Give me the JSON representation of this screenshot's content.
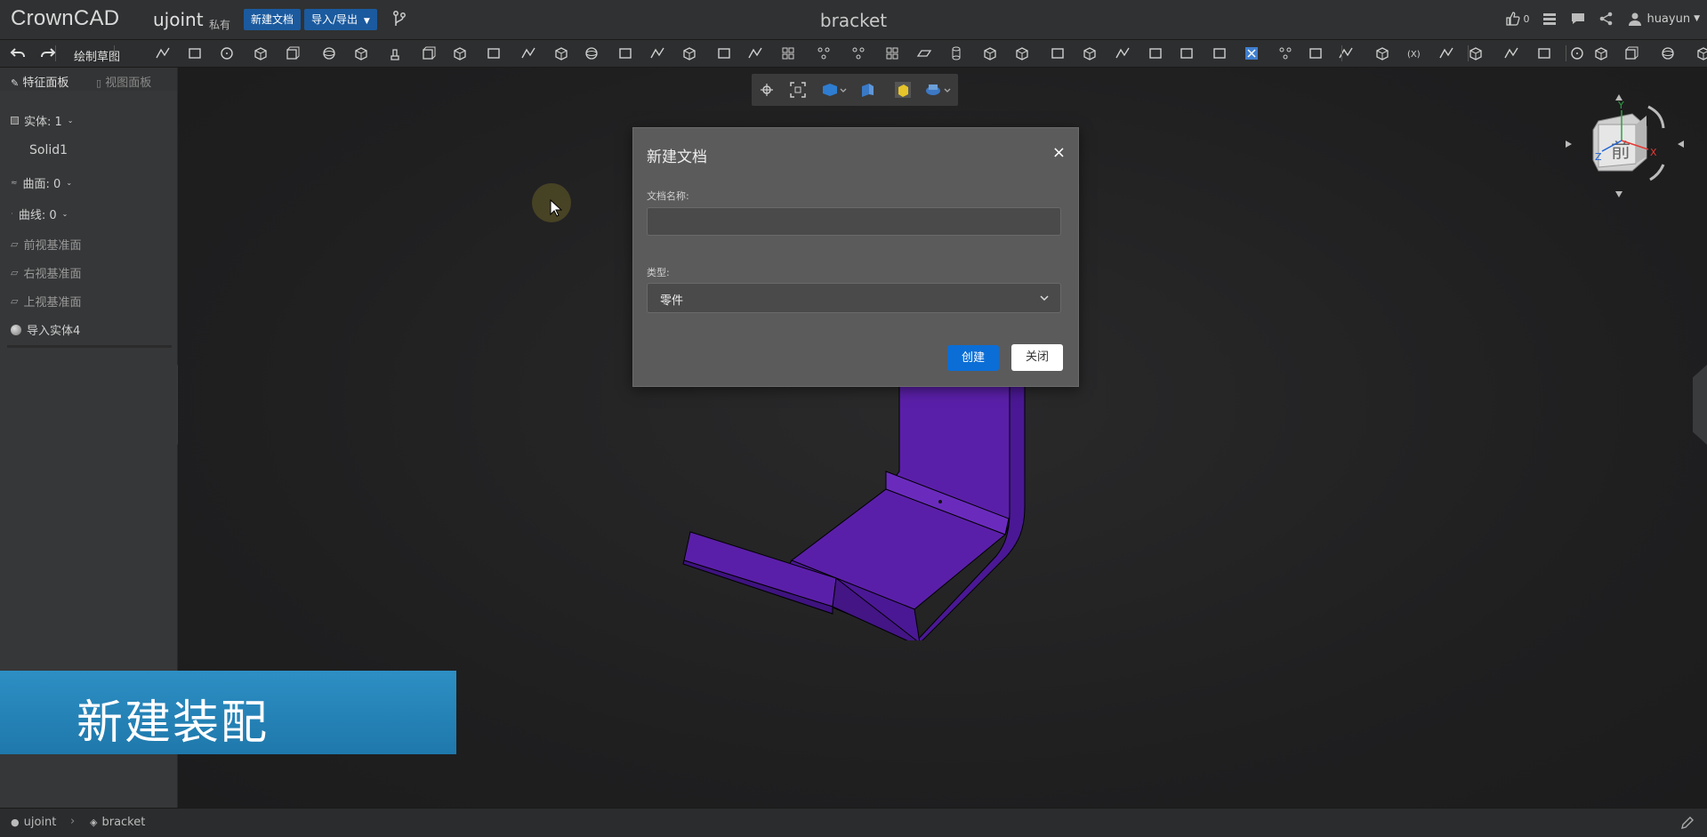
{
  "app": {
    "logo": "CrownCAD",
    "project": "ujoint",
    "privacy": "私有",
    "new_doc_label": "新建文档",
    "import_export_label": "导入/导出",
    "doc_title": "bracket",
    "like_count": "0",
    "user": "huayun"
  },
  "toolbar": {
    "sketch_label": "绘制草图"
  },
  "panel": {
    "tab_feature": "特征面板",
    "tab_view": "视图面板",
    "tree": [
      {
        "label": "实体: 1",
        "expandable": true
      },
      {
        "label": "Solid1",
        "expandable": false
      },
      {
        "label": "曲面: 0",
        "expandable": true
      },
      {
        "label": "曲线: 0",
        "expandable": true
      },
      {
        "label": "前视基准面"
      },
      {
        "label": "右视基准面"
      },
      {
        "label": "上视基准面"
      },
      {
        "label": "导入实体4"
      }
    ]
  },
  "dialog": {
    "title": "新建文档",
    "close_symbol": "×",
    "name_label": "文档名称:",
    "name_value": "",
    "type_label": "类型:",
    "type_value": "零件",
    "create_label": "创建",
    "close_label": "关闭"
  },
  "caption": {
    "text": "新建装配"
  },
  "navcube": {
    "face_label": "前",
    "axis_x": "X",
    "axis_y": "Y",
    "axis_z": "Z"
  },
  "status": {
    "crumb_project": "ujoint",
    "crumb_doc": "bracket"
  },
  "colors": {
    "model": "#5a1fa8",
    "accent": "#0b6ed6",
    "caption_bg": "#2588bf"
  }
}
